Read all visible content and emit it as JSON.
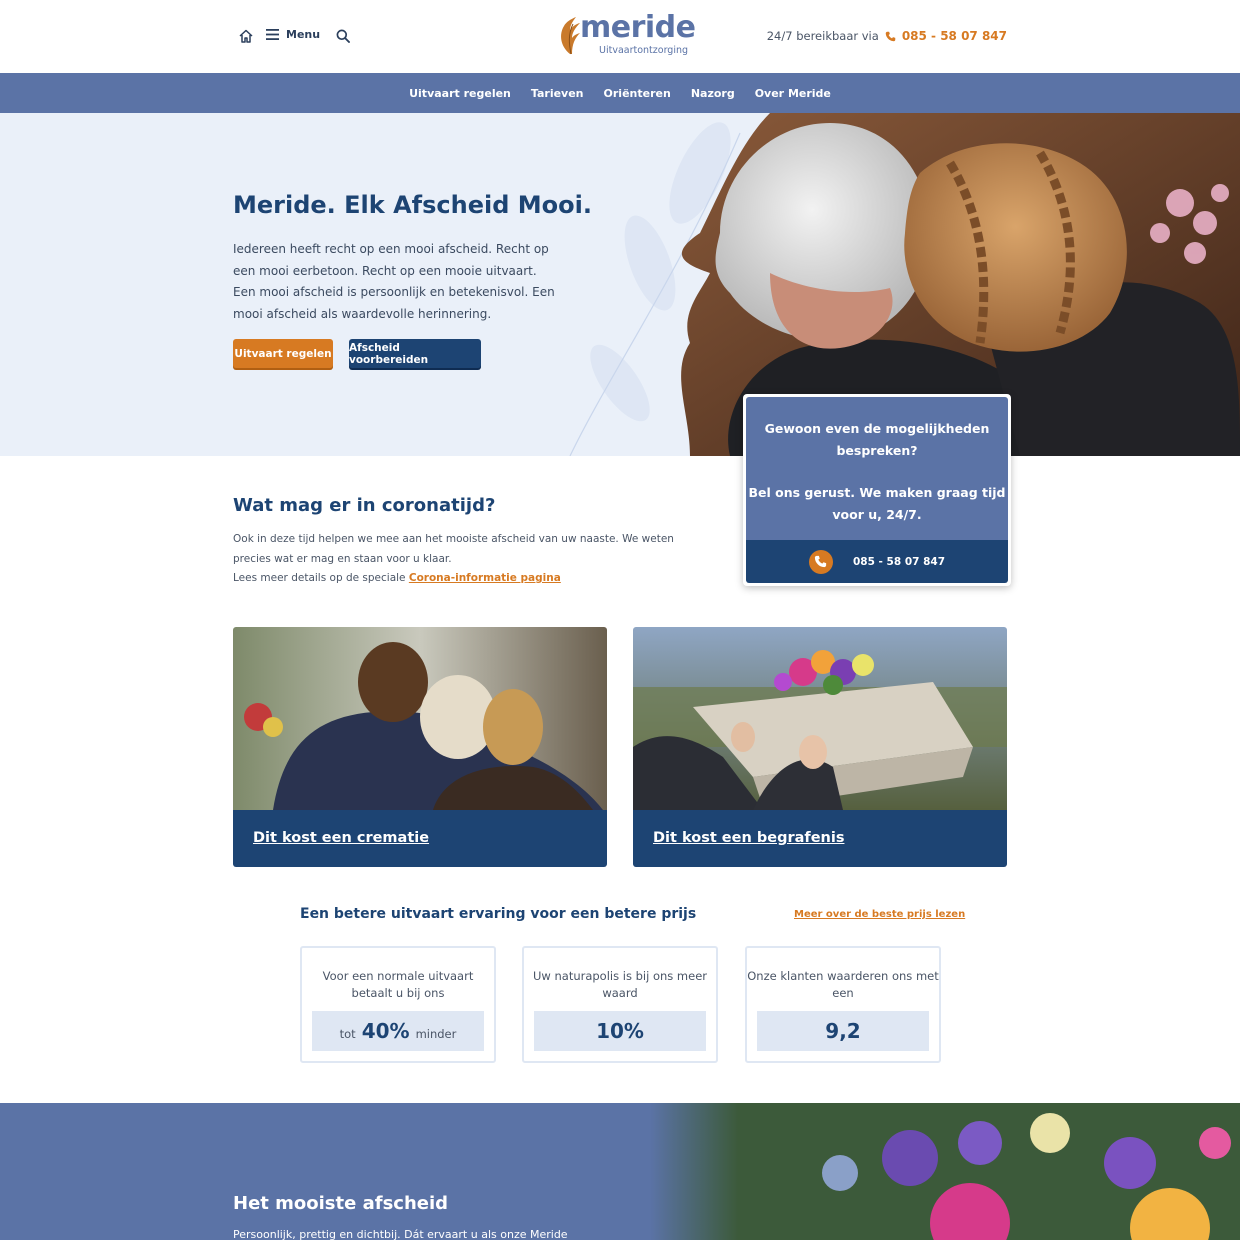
{
  "header": {
    "menu_label": "Menu",
    "logo_word": "meride",
    "logo_sub": "Uitvaartontzorging",
    "reach_text": "24/7 bereikbaar via",
    "reach_phone": "085 - 58 07 847"
  },
  "nav": {
    "items": [
      "Uitvaart regelen",
      "Tarieven",
      "Oriënteren",
      "Nazorg",
      "Over Meride"
    ]
  },
  "hero": {
    "title": "Meride. Elk Afscheid Mooi.",
    "text": "Iedereen heeft recht op een mooi afscheid. Recht op een mooi eerbetoon. Recht op een mooie uitvaart. Een mooi afscheid is persoonlijk en betekenisvol. Een mooi afscheid als waardevolle herinnering.",
    "btn_primary": "Uitvaart regelen",
    "btn_secondary": "Afscheid voorbereiden"
  },
  "call_card": {
    "line1": "Gewoon even de mogelijkheden bespreken?",
    "line2": "Bel ons gerust. We maken graag tijd voor u, 24/7.",
    "phone": "085 - 58 07 847"
  },
  "corona": {
    "title": "Wat mag er in coronatijd?",
    "text1": "Ook in deze tijd helpen we mee aan het mooiste afscheid van uw naaste. We weten precies wat er mag en staan voor u klaar.",
    "text2": "Lees meer details op de speciale",
    "link": "Corona-informatie pagina"
  },
  "cards": [
    {
      "label": "Dit kost een crematie"
    },
    {
      "label": "Dit kost een begrafenis"
    }
  ],
  "stats": {
    "title": "Een betere uitvaart ervaring voor een betere prijs",
    "link": "Meer over de beste prijs lezen",
    "items": [
      {
        "label": "Voor een normale uitvaart betaalt u bij ons",
        "prefix": "tot",
        "value": "40%",
        "suffix": "minder"
      },
      {
        "label": "Uw naturapolis is bij ons meer waard",
        "prefix": "",
        "value": "10%",
        "suffix": ""
      },
      {
        "label": "Onze klanten waarderen ons met een",
        "prefix": "",
        "value": "9,2",
        "suffix": ""
      }
    ]
  },
  "banner": {
    "title": "Het mooiste afscheid",
    "text": "Persoonlijk, prettig en dichtbij. Dát ervaart u als onze Meride"
  },
  "colors": {
    "primary_blue": "#1d4473",
    "nav_blue": "#5b73a6",
    "accent_orange": "#d77a22",
    "hero_bg": "#eaf0f9"
  }
}
